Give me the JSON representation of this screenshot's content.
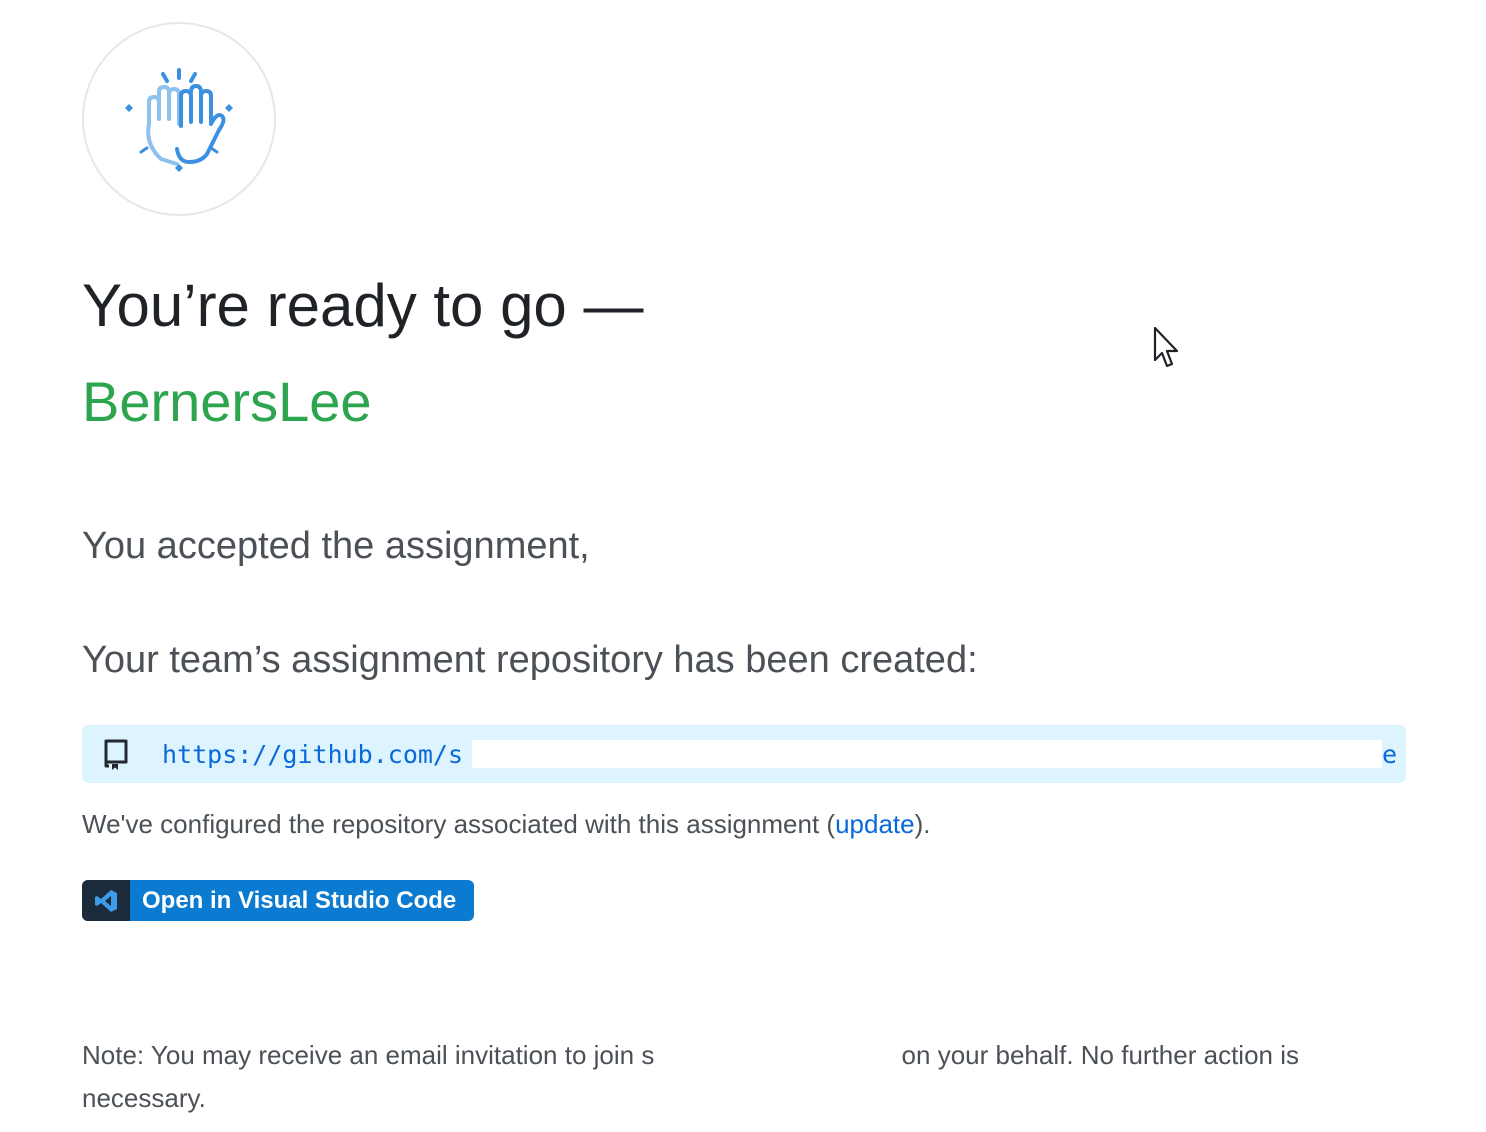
{
  "header": {
    "title": "You’re ready to go —",
    "team_name": "BernersLee"
  },
  "assignment": {
    "accepted_text": "You accepted the assignment,"
  },
  "repository": {
    "created_text": "Your team’s assignment repository has been created:",
    "url_prefix": "https://github.com/s",
    "url_suffix_char": "e"
  },
  "configured": {
    "text_before": "We've configured the repository associated with this assignment (",
    "update_link": "update",
    "text_after": ")."
  },
  "vscode_button": {
    "label": "Open in Visual Studio Code"
  },
  "note": {
    "text_before": "Note: You may receive an email invitation to join s",
    "text_after": " on your behalf. No further action is necessary."
  },
  "colors": {
    "accent_green": "#2da44e",
    "link_blue": "#0969da",
    "repo_box_bg": "#ddf4ff",
    "vscode_blue": "#0b7bd1",
    "vscode_dark": "#1b2b3c",
    "icon_blue": "#3d8fe0"
  },
  "icons": {
    "avatar": "high-five-icon",
    "repo": "repo-icon",
    "vscode": "vscode-icon",
    "cursor": "mouse-pointer-icon"
  }
}
